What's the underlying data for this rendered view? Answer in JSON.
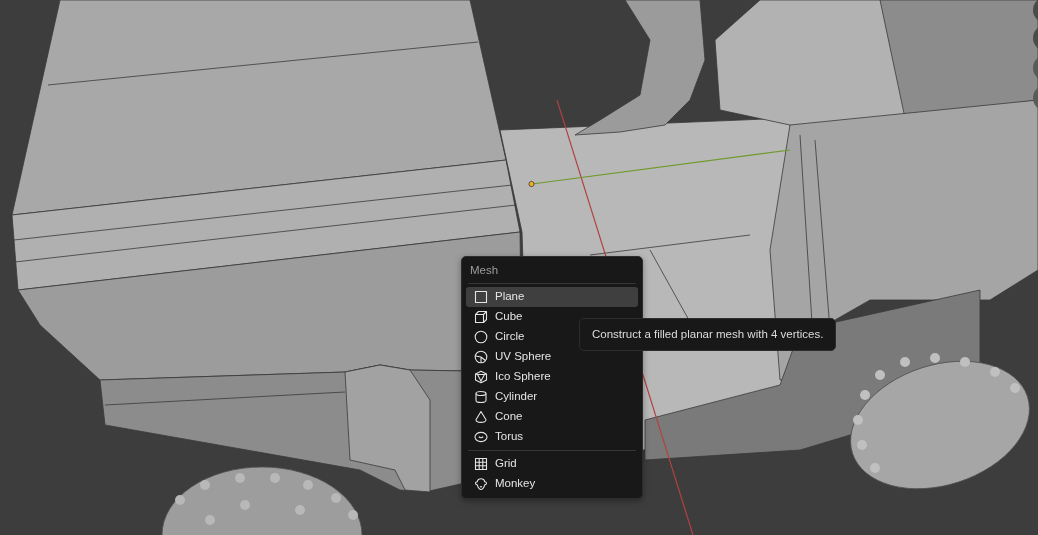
{
  "menu": {
    "title": "Mesh",
    "sections": [
      {
        "items": [
          {
            "label": "Plane",
            "kind": "plane",
            "selected": true
          },
          {
            "label": "Cube",
            "kind": "cube",
            "selected": false
          },
          {
            "label": "Circle",
            "kind": "circle",
            "selected": false
          },
          {
            "label": "UV Sphere",
            "kind": "uvsphere",
            "selected": false
          },
          {
            "label": "Ico Sphere",
            "kind": "icosphere",
            "selected": false
          },
          {
            "label": "Cylinder",
            "kind": "cylinder",
            "selected": false
          },
          {
            "label": "Cone",
            "kind": "cone",
            "selected": false
          },
          {
            "label": "Torus",
            "kind": "torus",
            "selected": false
          }
        ]
      },
      {
        "items": [
          {
            "label": "Grid",
            "kind": "grid",
            "selected": false
          },
          {
            "label": "Monkey",
            "kind": "monkey",
            "selected": false
          }
        ]
      }
    ]
  },
  "tooltip": {
    "text": "Construct a filled planar mesh with 4 vertices."
  }
}
